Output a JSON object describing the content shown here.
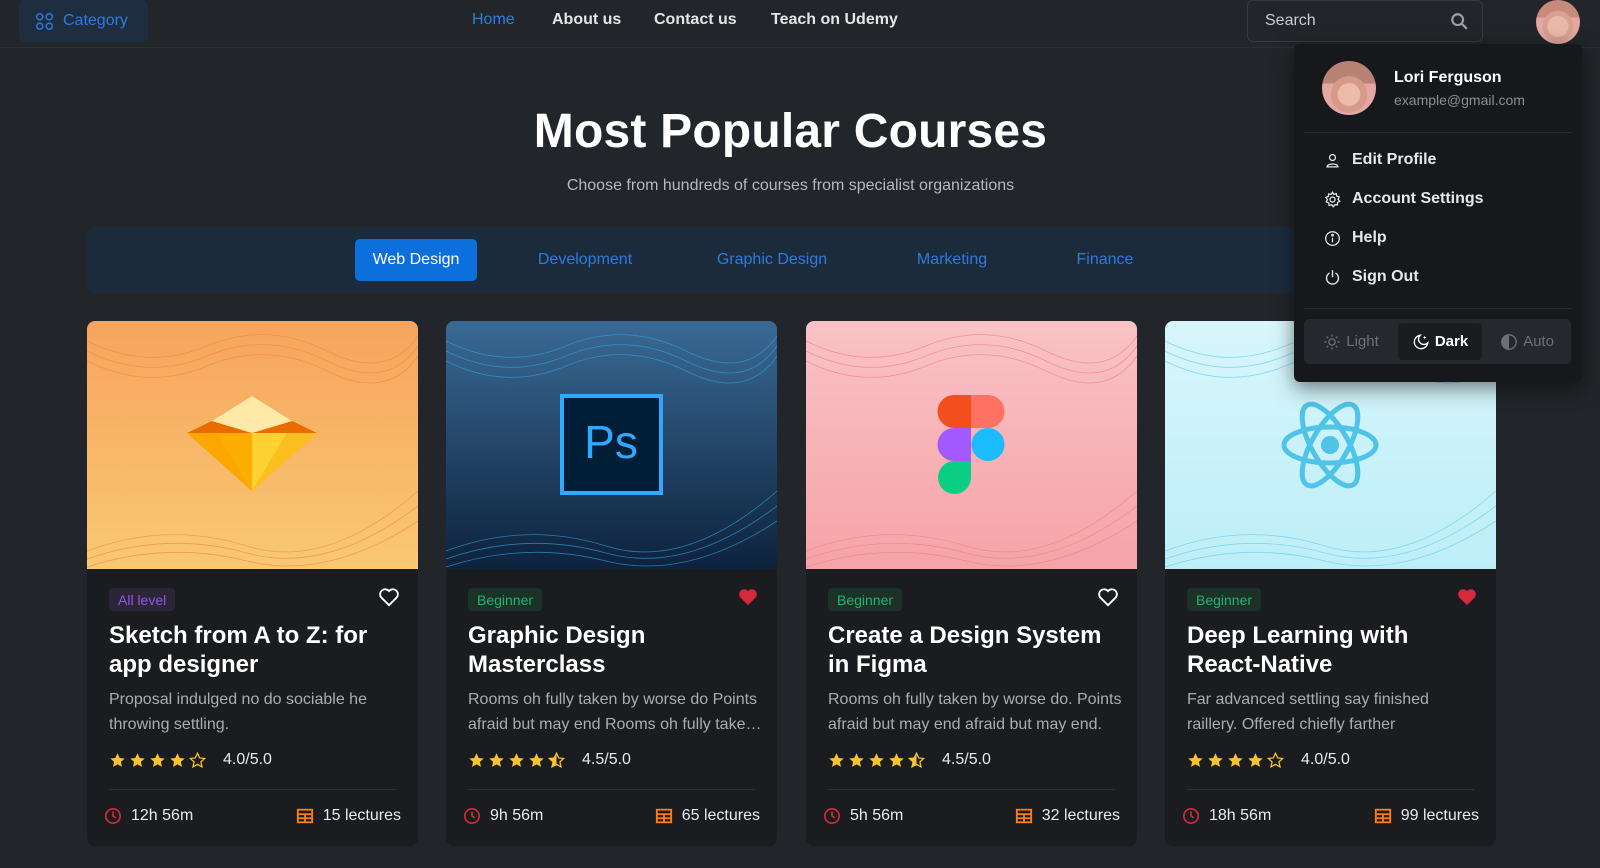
{
  "header": {
    "category_label": "Category",
    "nav": [
      {
        "label": "Home",
        "active": true
      },
      {
        "label": "About us"
      },
      {
        "label": "Contact us"
      },
      {
        "label": "Teach on Udemy"
      }
    ],
    "search_placeholder": "Search"
  },
  "hero": {
    "title": "Most Popular Courses",
    "subtitle": "Choose from hundreds of courses from specialist organizations"
  },
  "tabs": [
    {
      "label": "Web Design",
      "active": true
    },
    {
      "label": "Development"
    },
    {
      "label": "Graphic Design"
    },
    {
      "label": "Marketing"
    },
    {
      "label": "Finance"
    }
  ],
  "courses": [
    {
      "level": "All level",
      "title": "Sketch from A to Z: for app designer",
      "description": "Proposal indulged no do sociable he throwing settling.",
      "rating": 4.0,
      "rating_text": "4.0/5.0",
      "duration": "12h 56m",
      "lectures": "15 lectures",
      "favorite": false,
      "icon": "sketch-logo-icon"
    },
    {
      "level": "Beginner",
      "title": "Graphic Design Masterclass",
      "description": "Rooms oh fully taken by worse do Points afraid but may end Rooms oh fully taken by worse do.",
      "rating": 4.5,
      "rating_text": "4.5/5.0",
      "duration": "9h 56m",
      "lectures": "65 lectures",
      "favorite": true,
      "icon": "photoshop-logo-icon"
    },
    {
      "level": "Beginner",
      "title": "Create a Design System in Figma",
      "description": "Rooms oh fully taken by worse do. Points afraid but may end afraid but may end.",
      "rating": 4.5,
      "rating_text": "4.5/5.0",
      "duration": "5h 56m",
      "lectures": "32 lectures",
      "favorite": false,
      "icon": "figma-logo-icon"
    },
    {
      "level": "Beginner",
      "title": "Deep Learning with React-Native",
      "description": "Far advanced settling say finished raillery. Offered chiefly farther",
      "rating": 4.0,
      "rating_text": "4.0/5.0",
      "duration": "18h 56m",
      "lectures": "99 lectures",
      "favorite": true,
      "icon": "react-logo-icon"
    }
  ],
  "profile_menu": {
    "name": "Lori Ferguson",
    "email": "example@gmail.com",
    "items": [
      {
        "label": "Edit Profile",
        "icon": "user-icon"
      },
      {
        "label": "Account Settings",
        "icon": "gear-icon"
      },
      {
        "label": "Help",
        "icon": "info-icon"
      },
      {
        "label": "Sign Out",
        "icon": "power-icon"
      }
    ],
    "theme_options": [
      {
        "label": "Light",
        "icon": "sun-icon"
      },
      {
        "label": "Dark",
        "icon": "moon-icon",
        "active": true
      },
      {
        "label": "Auto",
        "icon": "half-circle-icon"
      }
    ]
  },
  "colors": {
    "background": "#222529",
    "accent": "#0d6fdb",
    "star": "#f7c32e",
    "heart_active": "#d6293e",
    "card_bg": "#1a1c1f"
  }
}
